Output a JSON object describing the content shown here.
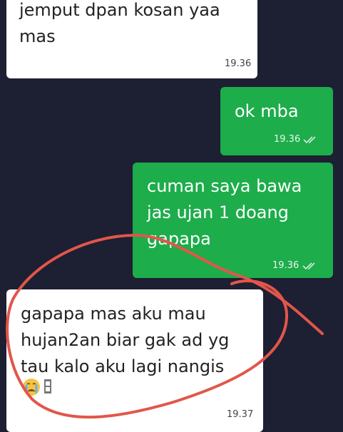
{
  "colors": {
    "background": "#1d1f33",
    "incoming_bubble": "#ffffff",
    "outgoing_bubble": "#1dad4b",
    "annotation_circle": "#e2564a"
  },
  "messages": [
    {
      "direction": "incoming",
      "text": "jemput dpan kosan yaa\nmas",
      "time": "19.36"
    },
    {
      "direction": "outgoing",
      "text": "ok mba",
      "time": "19.36",
      "status_icon": "double-check-icon"
    },
    {
      "direction": "outgoing",
      "text": "cuman saya bawa\njas ujan 1 doang\ngapapa",
      "time": "19.36",
      "status_icon": "double-check-icon"
    },
    {
      "direction": "incoming",
      "text": "gapapa mas aku mau\nhujan2an biar gak ad yg\ntau kalo aku lagi nangis",
      "emoji": "crying-face-emoji",
      "time": "19.37"
    }
  ]
}
